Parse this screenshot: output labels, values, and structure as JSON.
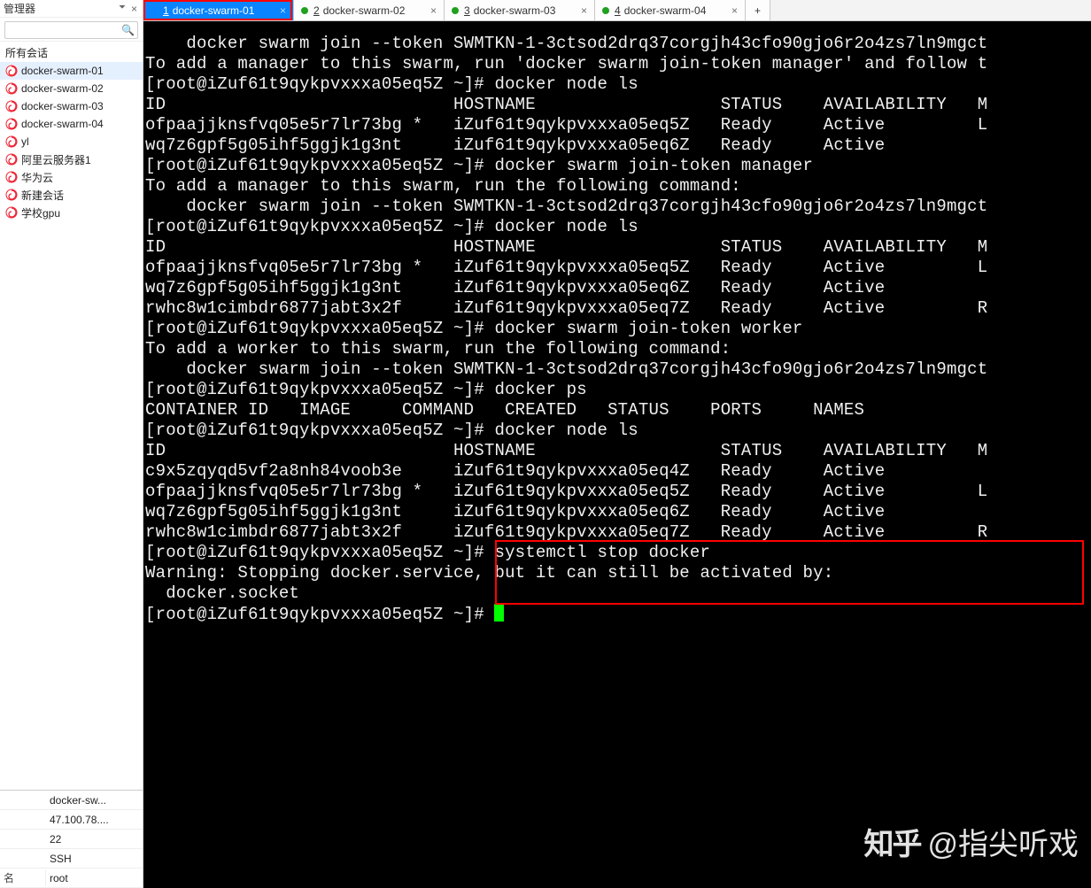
{
  "sidebar": {
    "title": "管理器",
    "pin_icon": "📌",
    "close_icon": "×",
    "search_placeholder": "",
    "group_label": "所有会话",
    "sessions": [
      {
        "label": "docker-swarm-01"
      },
      {
        "label": "docker-swarm-02"
      },
      {
        "label": "docker-swarm-03"
      },
      {
        "label": "docker-swarm-04"
      },
      {
        "label": "yl"
      },
      {
        "label": "阿里云服务器1"
      },
      {
        "label": "华为云"
      },
      {
        "label": "新建会话"
      },
      {
        "label": "学校gpu"
      }
    ],
    "properties": [
      {
        "key": "",
        "value": "docker-sw..."
      },
      {
        "key": "",
        "value": "47.100.78...."
      },
      {
        "key": "",
        "value": "22"
      },
      {
        "key": "",
        "value": "SSH"
      },
      {
        "key": "名",
        "value": "root"
      }
    ]
  },
  "tabs": [
    {
      "index": "1",
      "label": "docker-swarm-01",
      "active": true,
      "dirty": false
    },
    {
      "index": "2",
      "label": "docker-swarm-02",
      "active": false,
      "dirty": true
    },
    {
      "index": "3",
      "label": "docker-swarm-03",
      "active": false,
      "dirty": true
    },
    {
      "index": "4",
      "label": "docker-swarm-04",
      "active": false,
      "dirty": true
    }
  ],
  "add_tab_label": "+",
  "terminal": {
    "lines": [
      "",
      "    docker swarm join --token SWMTKN-1-3ctsod2drq37corgjh43cfo90gjo6r2o4zs7ln9mgct",
      "",
      "To add a manager to this swarm, run 'docker swarm join-token manager' and follow t",
      "",
      "[root@iZuf61t9qykpvxxxa05eq5Z ~]# docker node ls",
      "ID                            HOSTNAME                  STATUS    AVAILABILITY   M",
      "ofpaajjknsfvq05e5r7lr73bg *   iZuf61t9qykpvxxxa05eq5Z   Ready     Active         L",
      "wq7z6gpf5g05ihf5ggjk1g3nt     iZuf61t9qykpvxxxa05eq6Z   Ready     Active",
      "[root@iZuf61t9qykpvxxxa05eq5Z ~]# docker swarm join-token manager",
      "To add a manager to this swarm, run the following command:",
      "",
      "    docker swarm join --token SWMTKN-1-3ctsod2drq37corgjh43cfo90gjo6r2o4zs7ln9mgct",
      "",
      "[root@iZuf61t9qykpvxxxa05eq5Z ~]# docker node ls",
      "ID                            HOSTNAME                  STATUS    AVAILABILITY   M",
      "ofpaajjknsfvq05e5r7lr73bg *   iZuf61t9qykpvxxxa05eq5Z   Ready     Active         L",
      "wq7z6gpf5g05ihf5ggjk1g3nt     iZuf61t9qykpvxxxa05eq6Z   Ready     Active",
      "rwhc8w1cimbdr6877jabt3x2f     iZuf61t9qykpvxxxa05eq7Z   Ready     Active         R",
      "[root@iZuf61t9qykpvxxxa05eq5Z ~]# docker swarm join-token worker",
      "To add a worker to this swarm, run the following command:",
      "",
      "    docker swarm join --token SWMTKN-1-3ctsod2drq37corgjh43cfo90gjo6r2o4zs7ln9mgct",
      "",
      "[root@iZuf61t9qykpvxxxa05eq5Z ~]# docker ps",
      "CONTAINER ID   IMAGE     COMMAND   CREATED   STATUS    PORTS     NAMES",
      "[root@iZuf61t9qykpvxxxa05eq5Z ~]# docker node ls",
      "ID                            HOSTNAME                  STATUS    AVAILABILITY   M",
      "c9x5zqyqd5vf2a8nh84voob3e     iZuf61t9qykpvxxxa05eq4Z   Ready     Active",
      "ofpaajjknsfvq05e5r7lr73bg *   iZuf61t9qykpvxxxa05eq5Z   Ready     Active         L",
      "wq7z6gpf5g05ihf5ggjk1g3nt     iZuf61t9qykpvxxxa05eq6Z   Ready     Active",
      "rwhc8w1cimbdr6877jabt3x2f     iZuf61t9qykpvxxxa05eq7Z   Ready     Active         R",
      "[root@iZuf61t9qykpvxxxa05eq5Z ~]# systemctl stop docker",
      "Warning: Stopping docker.service, but it can still be activated by:",
      "  docker.socket",
      "[root@iZuf61t9qykpvxxxa05eq5Z ~]# "
    ]
  },
  "watermark": {
    "logo": "知乎",
    "text": "@指尖听戏"
  }
}
